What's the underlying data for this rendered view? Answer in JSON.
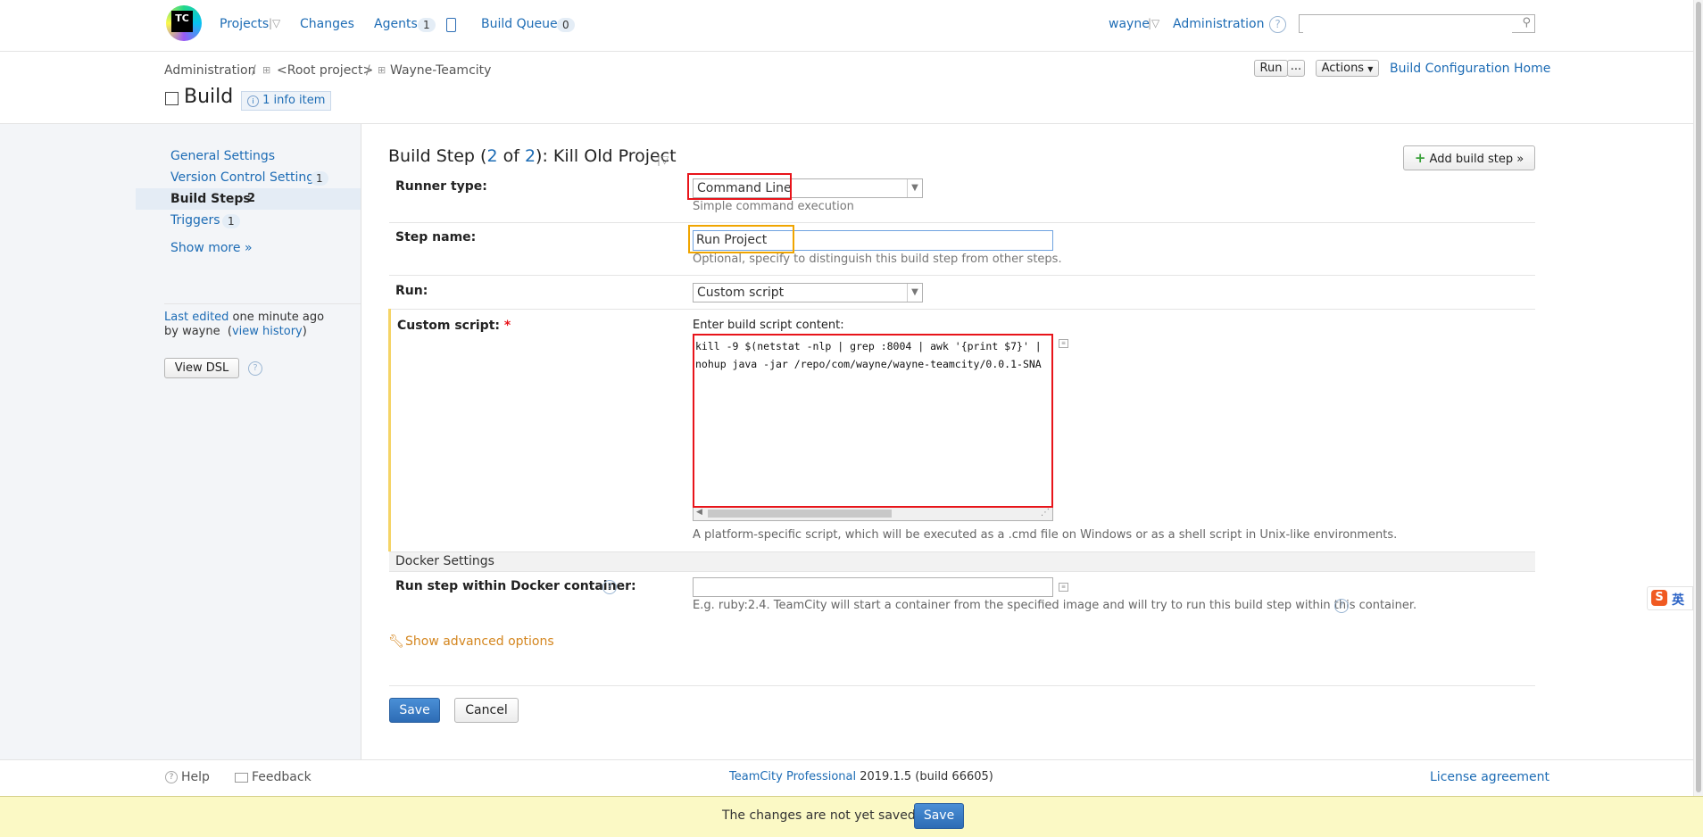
{
  "topnav": {
    "logo_text": "TC",
    "projects": "Projects",
    "changes": "Changes",
    "agents": "Agents",
    "agents_count": "1",
    "build_queue": "Build Queue",
    "build_queue_count": "0",
    "user": "wayne",
    "administration": "Administration",
    "search_placeholder": ""
  },
  "breadcrumb": {
    "admin": "Administration",
    "sep": "/",
    "root": "<Root project>",
    "project": "Wayne-Teamcity"
  },
  "header": {
    "title": "Build",
    "info_item": "1 info item",
    "run": "Run",
    "run_more": "...",
    "actions": "Actions",
    "build_config_home": "Build Configuration Home"
  },
  "sidebar": {
    "items": [
      {
        "label": "General Settings",
        "count": ""
      },
      {
        "label": "Version Control Settings",
        "count": "1"
      },
      {
        "label": "Build Steps",
        "count": "2"
      },
      {
        "label": "Triggers",
        "count": "1"
      }
    ],
    "show_more": "Show more »",
    "last_edited_link": "Last edited",
    "last_edited_rest": " one minute ago",
    "by_user": "by wayne",
    "view_history": "view history",
    "view_dsl": "View DSL"
  },
  "main": {
    "step_title_prefix": "Build Step (",
    "step_index": "2",
    "step_of": " of ",
    "step_total": "2",
    "step_title_suffix": "): Kill Old Project",
    "add_build_step": "Add build step »",
    "runner_type_label": "Runner type:",
    "runner_type_value": "Command Line",
    "runner_type_hint": "Simple command execution",
    "step_name_label": "Step name:",
    "step_name_value": "Run Project",
    "step_name_hint": "Optional, specify to distinguish this build step from other steps.",
    "run_label": "Run:",
    "run_value": "Custom script",
    "custom_script_label": "Custom script:",
    "required_star": "*",
    "script_caption": "Enter build script content:",
    "script_line1": "kill -9 $(netstat -nlp | grep :8004 | awk '{print $7}' |",
    "script_line2": "nohup java -jar /repo/com/wayne/wayne-teamcity/0.0.1-SNA",
    "script_hint": "A platform-specific script, which will be executed as a .cmd file on Windows or as a shell script in Unix-like environments.",
    "docker_section": "Docker Settings",
    "docker_label": "Run step within Docker container:",
    "docker_hint": "E.g. ruby:2.4. TeamCity will start a container from the specified image and will try to run this build step within this container.",
    "show_advanced": "Show advanced options",
    "save": "Save",
    "cancel": "Cancel"
  },
  "footer": {
    "help": "Help",
    "feedback": "Feedback",
    "product": "TeamCity Professional",
    "version": " 2019.1.5 (build 66605)",
    "license": "License agreement"
  },
  "unsaved_bar": {
    "message": "The changes are not yet saved.",
    "save": "Save"
  },
  "ime": {
    "char": "英"
  },
  "colors": {
    "link": "#1d6cb5",
    "highlight_red": "#e8141a",
    "highlight_orange": "#f0a500",
    "unsaved_bg": "#fbf9c5"
  }
}
